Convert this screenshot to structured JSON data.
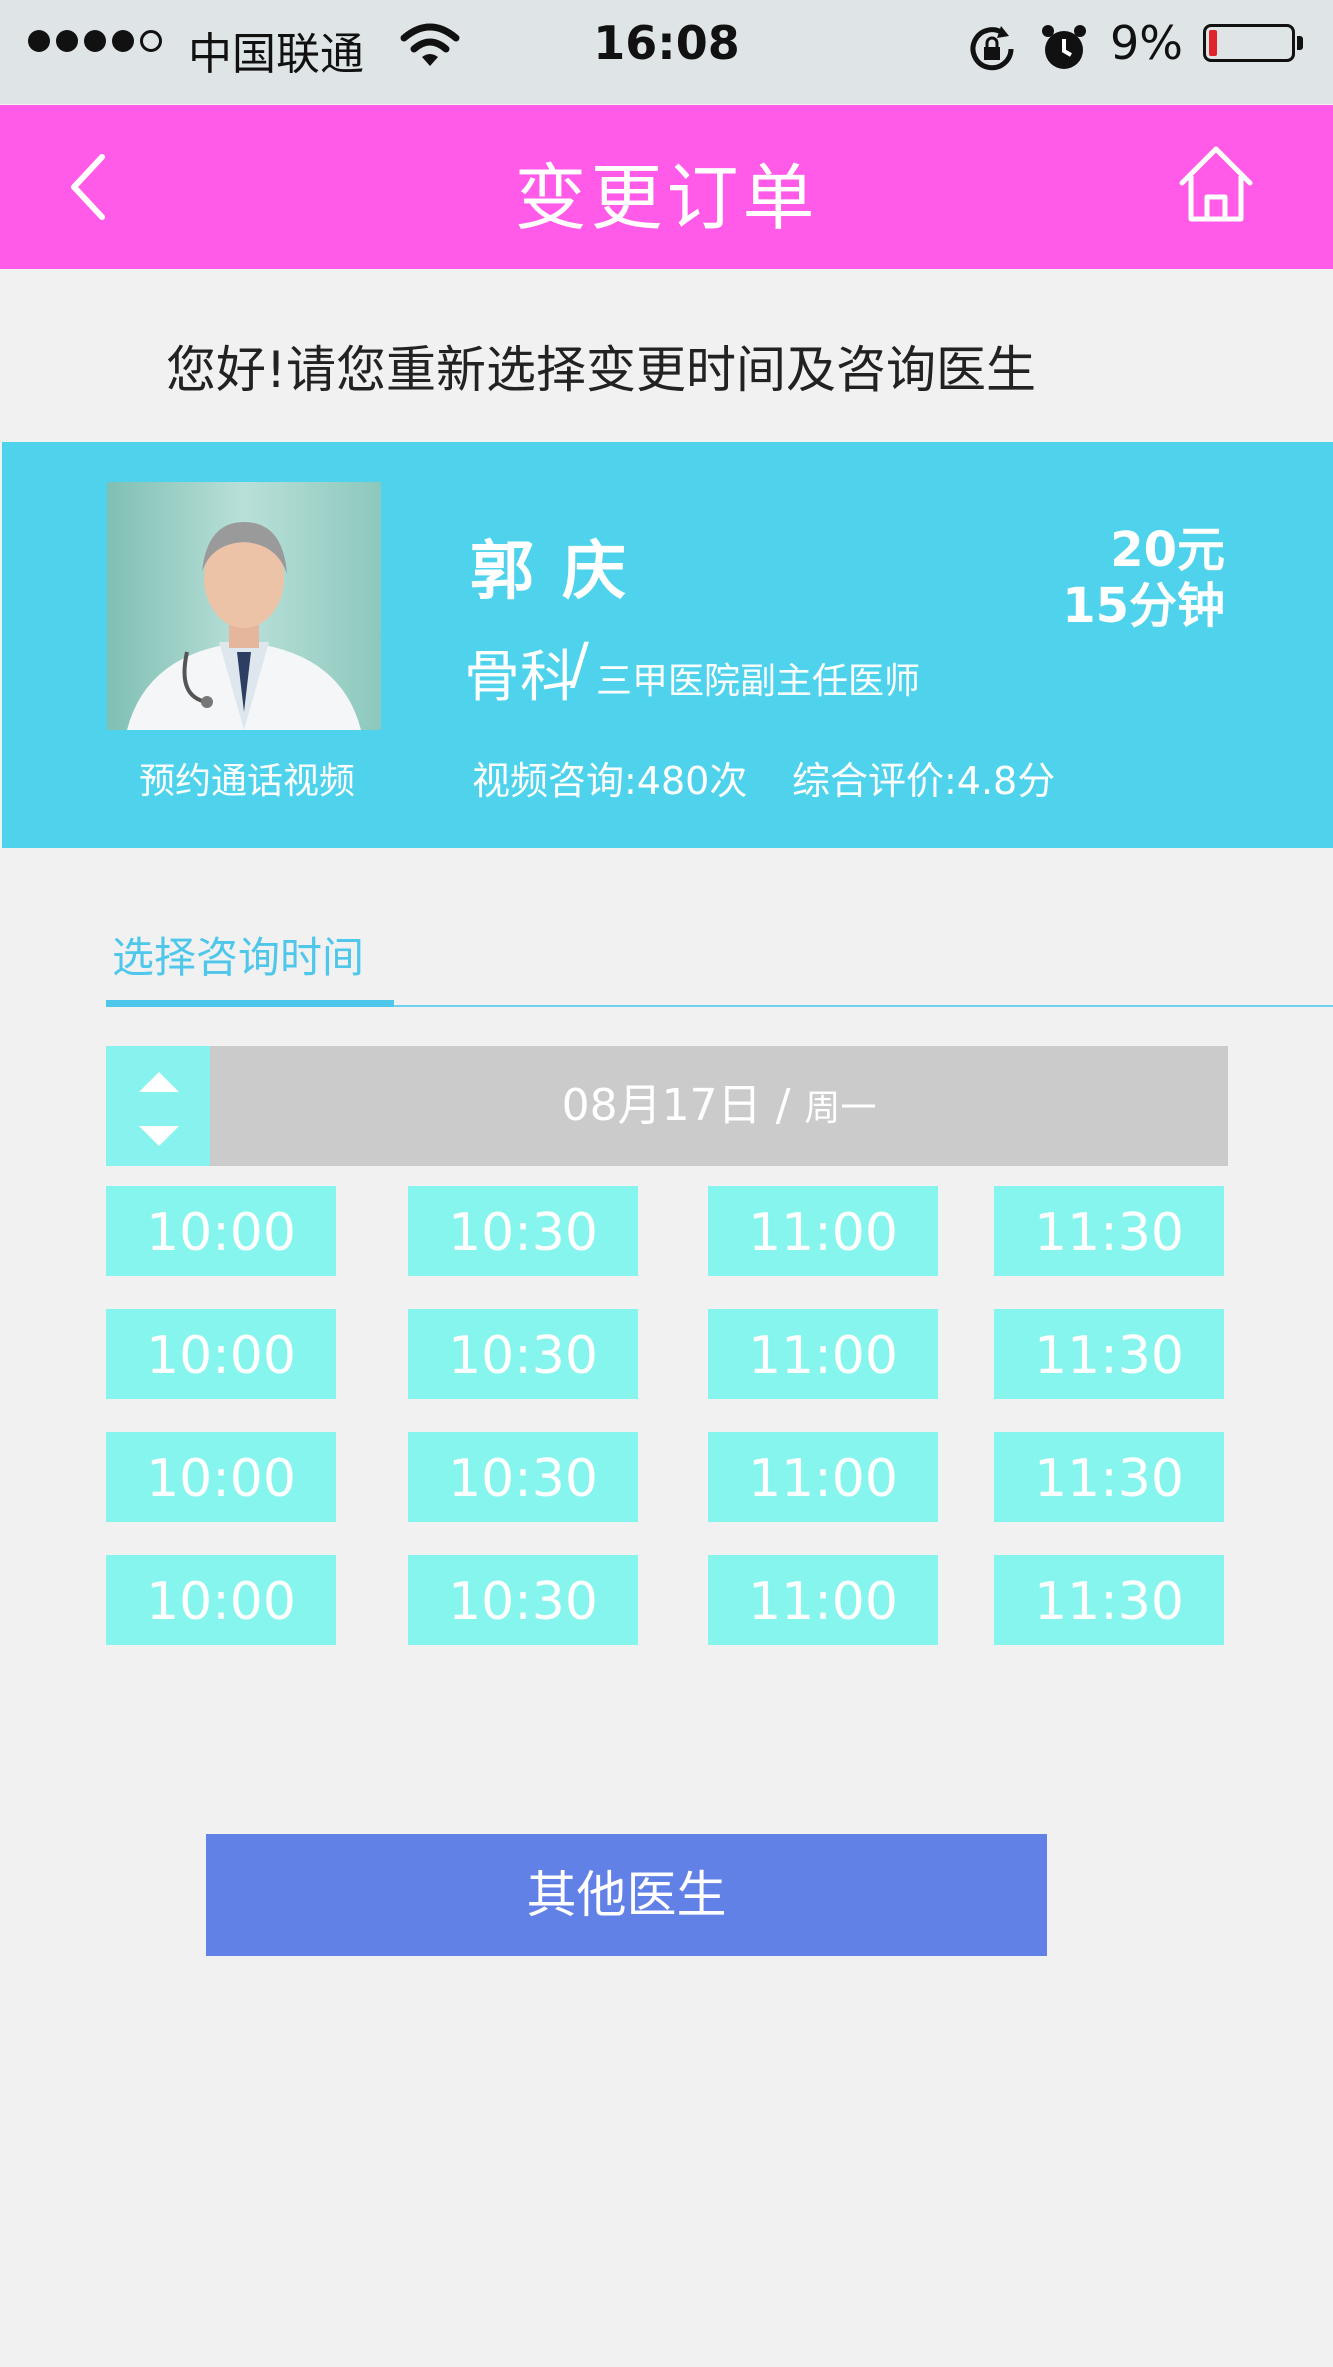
{
  "status_bar": {
    "carrier": "中国联通",
    "time": "16:08",
    "battery": "9%",
    "battery_color": "#e0242e"
  },
  "nav": {
    "title": "变更订单",
    "back_icon": "chevron-left-icon",
    "home_icon": "home-icon",
    "color": "#ff5ae8"
  },
  "greeting": "您好!请您重新选择变更时间及咨询医生",
  "doctor": {
    "name": "郭庆",
    "department": "骨科",
    "title": "三甲医院副主任医师",
    "price": "20元",
    "duration": "15分钟",
    "photo_caption": "预约通话视频",
    "consultations": "视频咨询:480次",
    "rating": "综合评价:4.8分",
    "card_color": "#4fd3ec"
  },
  "schedule": {
    "section_label": "选择咨询时间",
    "date": "08月17日",
    "separator": "/",
    "weekday": "周一",
    "slots": [
      [
        "10:00",
        "10:30",
        "11:00",
        "11:30"
      ],
      [
        "10:00",
        "10:30",
        "11:00",
        "11:30"
      ],
      [
        "10:00",
        "10:30",
        "11:00",
        "11:30"
      ],
      [
        "10:00",
        "10:30",
        "11:00",
        "11:30"
      ]
    ]
  },
  "other_doctor_button": "其他医生",
  "accent_color": "#6281e7"
}
